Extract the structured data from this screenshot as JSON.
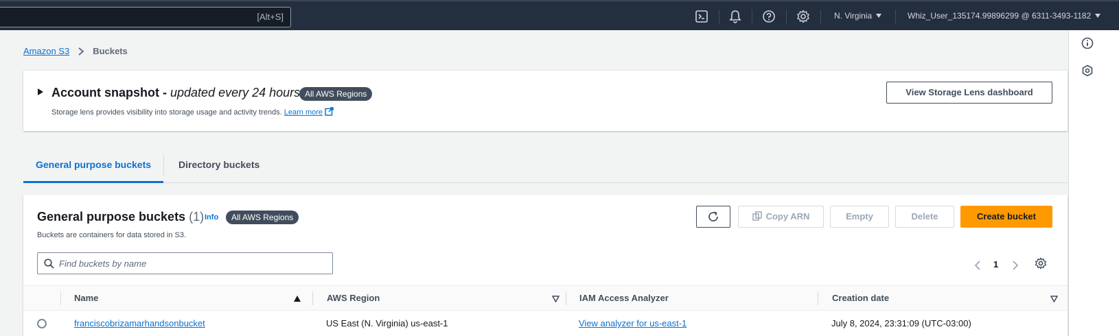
{
  "topnav": {
    "search_shortcut": "[Alt+S]",
    "region": "N. Virginia",
    "account": "Whiz_User_135174.99896299 @ 6311-3493-1182"
  },
  "breadcrumb": {
    "root": "Amazon S3",
    "current": "Buckets"
  },
  "snapshot": {
    "title": "Account snapshot - ",
    "title_italic": "updated every 24 hours",
    "badge": "All AWS Regions",
    "description": "Storage lens provides visibility into storage usage and activity trends.",
    "learn_more": "Learn more",
    "dashboard_button": "View Storage Lens dashboard"
  },
  "tabs": {
    "active": "General purpose buckets",
    "inactive": "Directory buckets"
  },
  "buckets": {
    "title": "General purpose buckets",
    "count": "(1)",
    "info": "Info",
    "badge": "All AWS Regions",
    "description": "Buckets are containers for data stored in S3.",
    "copy_arn": "Copy ARN",
    "empty": "Empty",
    "delete": "Delete",
    "create": "Create bucket",
    "filter_placeholder": "Find buckets by name",
    "page": "1",
    "columns": [
      "Name",
      "AWS Region",
      "IAM Access Analyzer",
      "Creation date"
    ],
    "rows": [
      {
        "name": "franciscobrizamarhandsonbucket",
        "region": "US East (N. Virginia) us-east-1",
        "analyzer": "View analyzer for us-east-1",
        "created": "July 8, 2024, 23:31:09 (UTC-03:00)"
      }
    ]
  }
}
